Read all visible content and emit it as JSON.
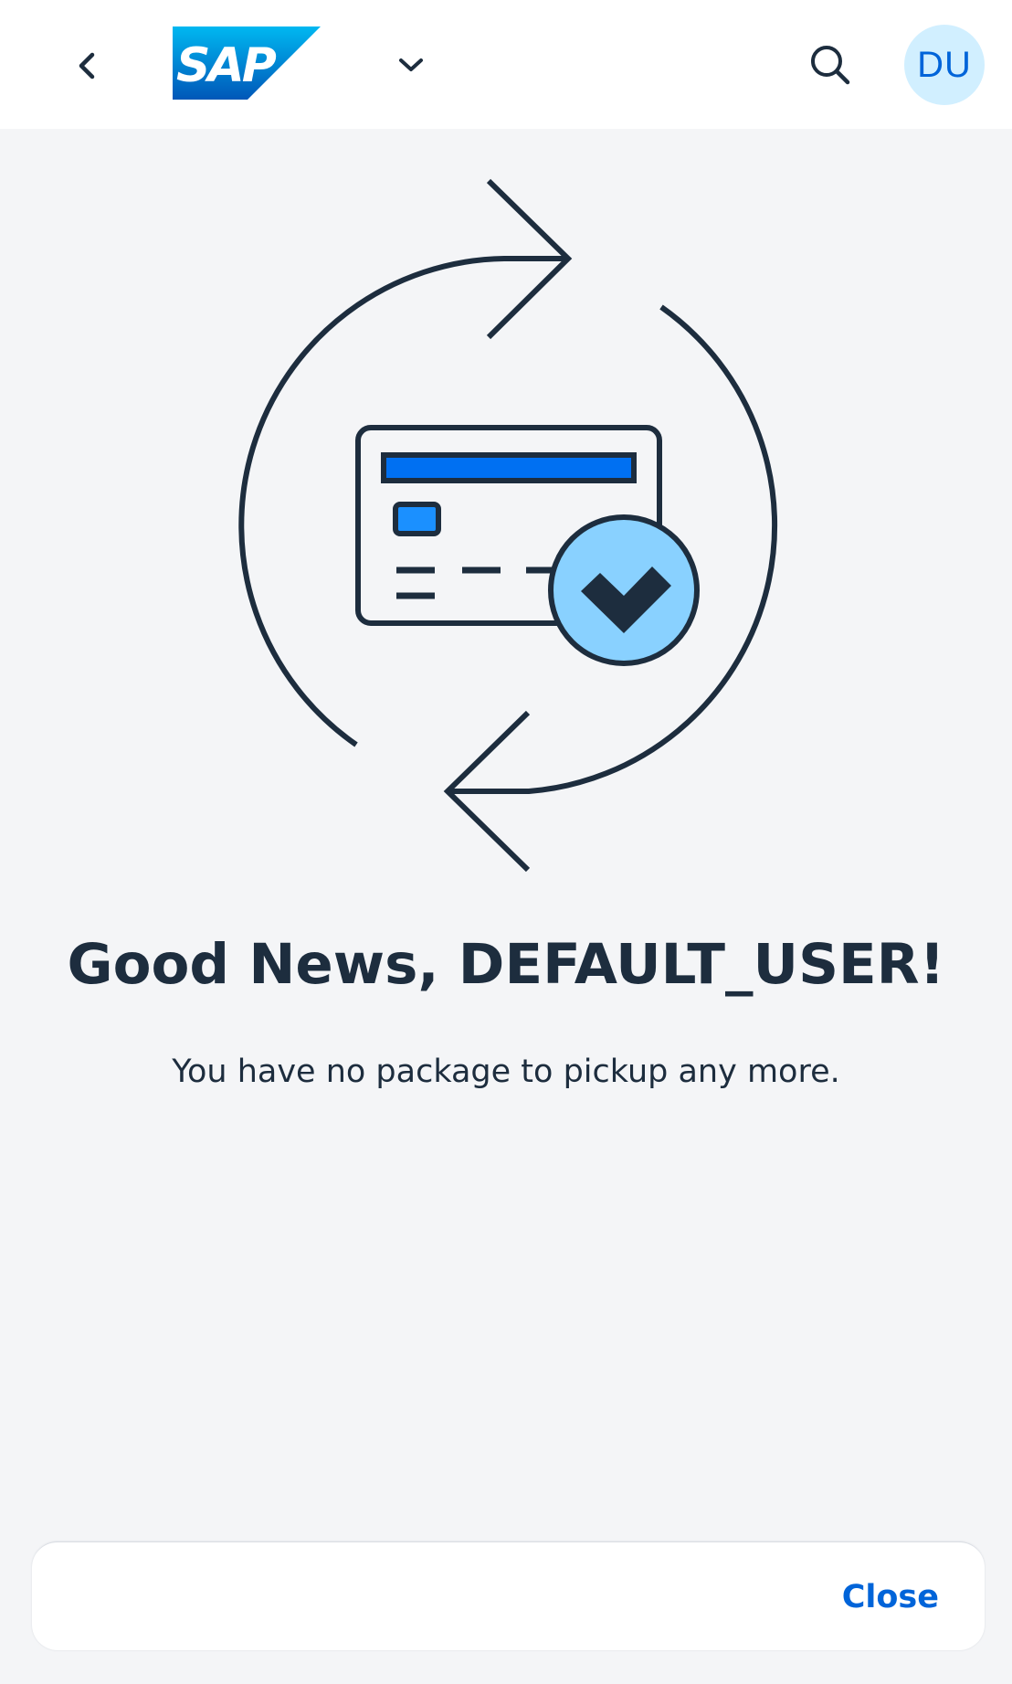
{
  "header": {
    "logo_text": "SAP",
    "avatar_initials": "DU",
    "icons": {
      "back": "chevron-left-icon",
      "menu": "chevron-down-icon",
      "search": "search-icon"
    }
  },
  "message": {
    "title": "Good News, DEFAULT_USER!",
    "description": "You have no package to pickup any more."
  },
  "footer": {
    "close_label": "Close"
  },
  "colors": {
    "accent": "#0064d9",
    "avatar_bg": "#d1efff",
    "text": "#1d2d3e",
    "background": "#f4f5f7",
    "illustration_blue": "#0070f2",
    "illustration_light_blue": "#89d1ff"
  }
}
